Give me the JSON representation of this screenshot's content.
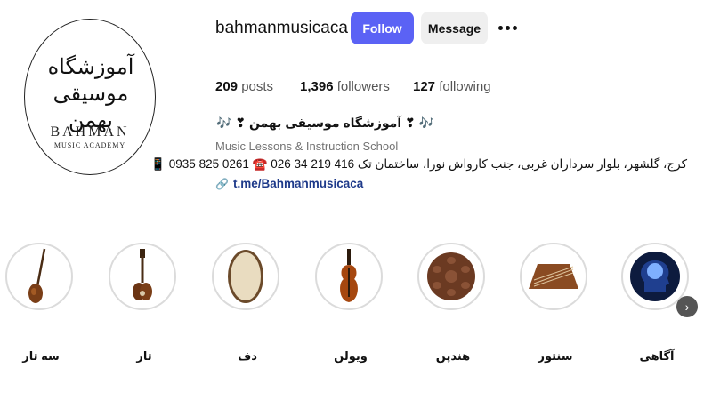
{
  "profile": {
    "avatar": {
      "calligraphy": "آموزشگاه موسیقی بهمن",
      "brand": "BAHMAN",
      "sub": "MUSIC ACADEMY"
    },
    "username": "bahmanmusicaca",
    "follow_label": "Follow",
    "message_label": "Message",
    "stats": {
      "posts_count": "209",
      "posts_label": "posts",
      "followers_count": "1,396",
      "followers_label": "followers",
      "following_count": "127",
      "following_label": "following"
    },
    "bio": {
      "name": "🎶 ❣ آموزشگاه موسیقی بهمن ❣ 🎶",
      "category": "Music Lessons & Instruction School",
      "address": "کرج، گلشهر، بلوار سرداران غربی، جنب کارواش نورا، ساختمان تک 416 219 34 026 ☎️ 0261 825 0935 📱",
      "link": "t.me/Bahmanmusicaca"
    }
  },
  "highlights": [
    {
      "label": "سه تار",
      "icon": "setar-icon"
    },
    {
      "label": "تار",
      "icon": "tar-icon"
    },
    {
      "label": "دف",
      "icon": "daf-icon"
    },
    {
      "label": "ویولن",
      "icon": "violin-icon"
    },
    {
      "label": "هندپن",
      "icon": "handpan-icon"
    },
    {
      "label": "سنتور",
      "icon": "santur-icon"
    },
    {
      "label": "آگاهی",
      "icon": "brain-icon"
    }
  ],
  "colors": {
    "follow_button": "#5b62f5",
    "message_button": "#efefef",
    "link": "#1e3a8a"
  }
}
